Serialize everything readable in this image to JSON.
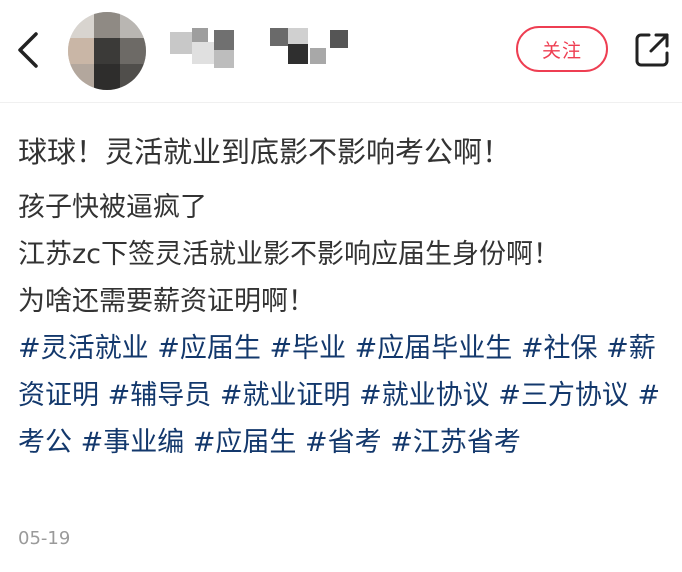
{
  "header": {
    "follow_label": "关注"
  },
  "post": {
    "title": "球球！灵活就业到底影不影响考公啊！",
    "body_lines": [
      "孩子快被逼疯了",
      "江苏zc下签灵活就业影不影响应届生身份啊！",
      "为啥还需要薪资证明啊！"
    ],
    "tags": [
      "#灵活就业",
      "#应届生",
      "#毕业",
      "#应届毕业生",
      "#社保",
      "#薪资证明",
      "#辅导员",
      "#就业证明",
      "#就业协议",
      "#三方协议",
      "#考公",
      "#事业编",
      "#应届生",
      "#省考",
      "#江苏省考"
    ],
    "date": "05-19"
  },
  "colors": {
    "accent": "#ee3e52",
    "tag": "#13386c",
    "text": "#333333",
    "muted": "#9a9a9a"
  },
  "icons": {
    "back": "chevron-left-icon",
    "share": "share-external-icon"
  }
}
